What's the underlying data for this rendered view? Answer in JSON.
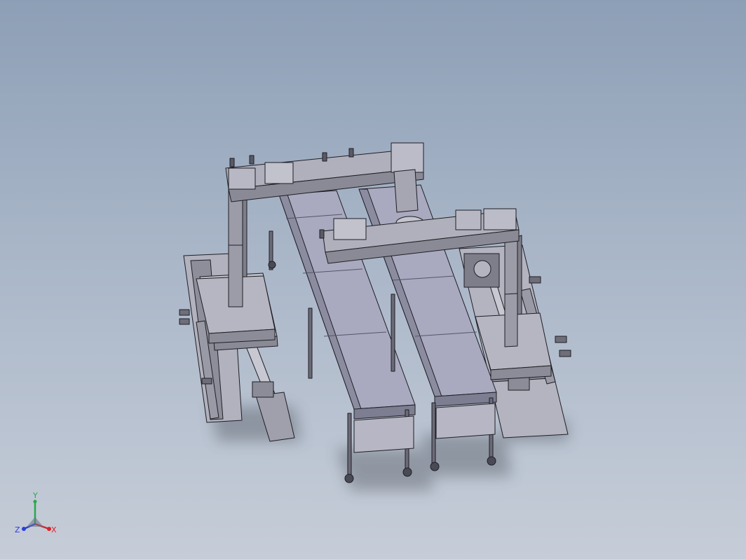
{
  "viewport": {
    "view": "isometric",
    "background_top": "#8d9fb6",
    "background_bottom": "#c6cdd8",
    "model_face_color": "#a8a8b4",
    "model_edge_color": "#1e1e24"
  },
  "triad": {
    "x_label": "X",
    "y_label": "Y",
    "z_label": "Z",
    "x_color": "#d8232a",
    "y_color": "#2aa84a",
    "z_color": "#2a3fd8"
  }
}
